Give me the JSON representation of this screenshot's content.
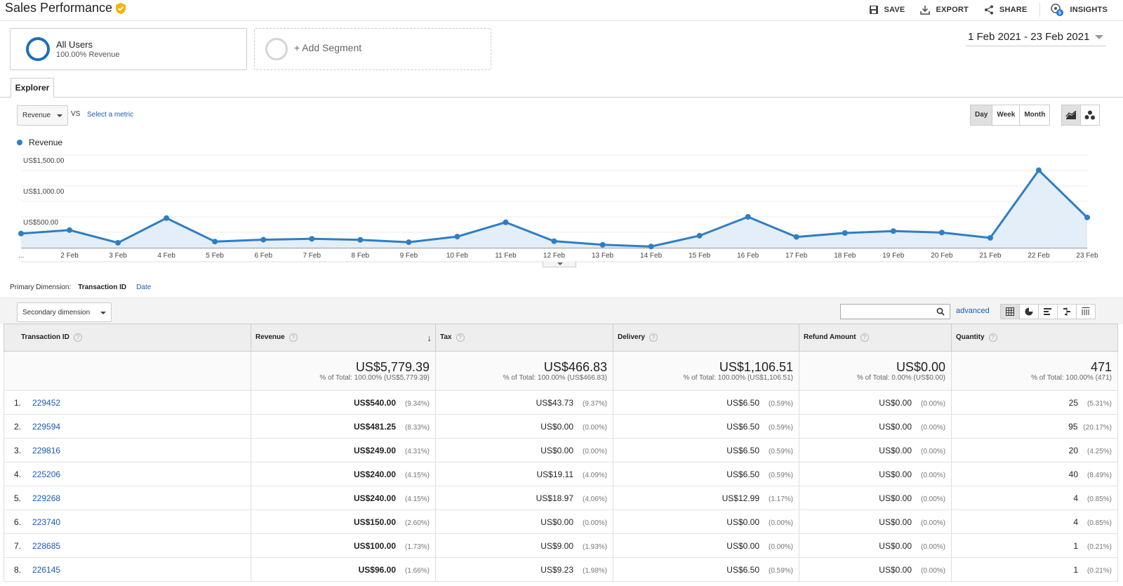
{
  "header": {
    "title": "Sales Performance",
    "actions": {
      "save": "SAVE",
      "export": "EXPORT",
      "share": "SHARE",
      "insights": "INSIGHTS",
      "insights_count": "5"
    }
  },
  "segments": {
    "all_users": {
      "name": "All Users",
      "sub": "100.00% Revenue"
    },
    "add_label": "+ Add Segment"
  },
  "date_range": "1 Feb 2021 - 23 Feb 2021",
  "explorer": {
    "tab": "Explorer",
    "metric": "Revenue",
    "vs": "VS",
    "select_metric": "Select a metric",
    "range": {
      "day": "Day",
      "week": "Week",
      "month": "Month",
      "active": "Day"
    }
  },
  "chart_data": {
    "type": "area",
    "series": [
      {
        "name": "Revenue",
        "values": [
          230,
          286,
          80,
          480,
          100,
          130,
          145,
          128,
          90,
          180,
          412,
          106,
          48,
          20,
          195,
          500,
          175,
          238,
          270,
          246,
          160,
          1255,
          490
        ]
      }
    ],
    "x": [
      "1 Feb",
      "2 Feb",
      "3 Feb",
      "4 Feb",
      "5 Feb",
      "6 Feb",
      "7 Feb",
      "8 Feb",
      "9 Feb",
      "10 Feb",
      "11 Feb",
      "12 Feb",
      "13 Feb",
      "14 Feb",
      "15 Feb",
      "16 Feb",
      "17 Feb",
      "18 Feb",
      "19 Feb",
      "20 Feb",
      "21 Feb",
      "22 Feb",
      "23 Feb"
    ],
    "x_tick_labels": [
      "...",
      "2 Feb",
      "3 Feb",
      "4 Feb",
      "5 Feb",
      "6 Feb",
      "7 Feb",
      "8 Feb",
      "9 Feb",
      "10 Feb",
      "11 Feb",
      "12 Feb",
      "13 Feb",
      "14 Feb",
      "15 Feb",
      "16 Feb",
      "17 Feb",
      "18 Feb",
      "19 Feb",
      "20 Feb",
      "21 Feb",
      "22 Feb",
      "23 Feb"
    ],
    "y_ticks": [
      {
        "value": 1500,
        "label": "US$1,500.00"
      },
      {
        "value": 1000,
        "label": "US$1,000.00"
      },
      {
        "value": 500,
        "label": "US$500.00"
      }
    ],
    "ylim": [
      0,
      1500
    ],
    "grid": true,
    "legend": "top-left",
    "color": "#2e7ec4"
  },
  "primary_dimension": {
    "label": "Primary Dimension:",
    "active": "Transaction ID",
    "other": "Date"
  },
  "toolbar": {
    "secondary_dimension": "Secondary dimension",
    "advanced": "advanced",
    "search_value": ""
  },
  "table": {
    "columns": [
      "Transaction ID",
      "Revenue",
      "Tax",
      "Delivery",
      "Refund Amount",
      "Quantity"
    ],
    "totals": [
      {
        "value": "US$5,779.39",
        "sub": "% of Total: 100.00% (US$5,779.39)"
      },
      {
        "value": "US$466.83",
        "sub": "% of Total: 100.00% (US$466.83)"
      },
      {
        "value": "US$1,106.51",
        "sub": "% of Total: 100.00% (US$1,106.51)"
      },
      {
        "value": "US$0.00",
        "sub": "% of Total: 0.00% (US$0.00)"
      },
      {
        "value": "471",
        "sub": "% of Total: 100.00% (471)"
      }
    ],
    "rows": [
      {
        "num": "1.",
        "id": "229452",
        "revenue": "US$540.00",
        "revenue_pct": "(9.34%)",
        "tax": "US$43.73",
        "tax_pct": "(9.37%)",
        "delivery": "US$6.50",
        "delivery_pct": "(0.59%)",
        "refund": "US$0.00",
        "refund_pct": "(0.00%)",
        "qty": "25",
        "qty_pct": "(5.31%)"
      },
      {
        "num": "2.",
        "id": "229594",
        "revenue": "US$481.25",
        "revenue_pct": "(8.33%)",
        "tax": "US$0.00",
        "tax_pct": "(0.00%)",
        "delivery": "US$6.50",
        "delivery_pct": "(0.59%)",
        "refund": "US$0.00",
        "refund_pct": "(0.00%)",
        "qty": "95",
        "qty_pct": "(20.17%)"
      },
      {
        "num": "3.",
        "id": "229816",
        "revenue": "US$249.00",
        "revenue_pct": "(4.31%)",
        "tax": "US$0.00",
        "tax_pct": "(0.00%)",
        "delivery": "US$6.50",
        "delivery_pct": "(0.59%)",
        "refund": "US$0.00",
        "refund_pct": "(0.00%)",
        "qty": "20",
        "qty_pct": "(4.25%)"
      },
      {
        "num": "4.",
        "id": "225206",
        "revenue": "US$240.00",
        "revenue_pct": "(4.15%)",
        "tax": "US$19.11",
        "tax_pct": "(4.09%)",
        "delivery": "US$6.50",
        "delivery_pct": "(0.59%)",
        "refund": "US$0.00",
        "refund_pct": "(0.00%)",
        "qty": "40",
        "qty_pct": "(8.49%)"
      },
      {
        "num": "5.",
        "id": "229268",
        "revenue": "US$240.00",
        "revenue_pct": "(4.15%)",
        "tax": "US$18.97",
        "tax_pct": "(4.06%)",
        "delivery": "US$12.99",
        "delivery_pct": "(1.17%)",
        "refund": "US$0.00",
        "refund_pct": "(0.00%)",
        "qty": "4",
        "qty_pct": "(0.85%)"
      },
      {
        "num": "6.",
        "id": "223740",
        "revenue": "US$150.00",
        "revenue_pct": "(2.60%)",
        "tax": "US$0.00",
        "tax_pct": "(0.00%)",
        "delivery": "US$0.00",
        "delivery_pct": "(0.00%)",
        "refund": "US$0.00",
        "refund_pct": "(0.00%)",
        "qty": "4",
        "qty_pct": "(0.85%)"
      },
      {
        "num": "7.",
        "id": "228685",
        "revenue": "US$100.00",
        "revenue_pct": "(1.73%)",
        "tax": "US$9.00",
        "tax_pct": "(1.93%)",
        "delivery": "US$0.00",
        "delivery_pct": "(0.00%)",
        "refund": "US$0.00",
        "refund_pct": "(0.00%)",
        "qty": "1",
        "qty_pct": "(0.21%)"
      },
      {
        "num": "8.",
        "id": "226145",
        "revenue": "US$96.00",
        "revenue_pct": "(1.66%)",
        "tax": "US$9.23",
        "tax_pct": "(1.98%)",
        "delivery": "US$6.50",
        "delivery_pct": "(0.59%)",
        "refund": "US$0.00",
        "refund_pct": "(0.00%)",
        "qty": "1",
        "qty_pct": "(0.21%)"
      }
    ]
  }
}
